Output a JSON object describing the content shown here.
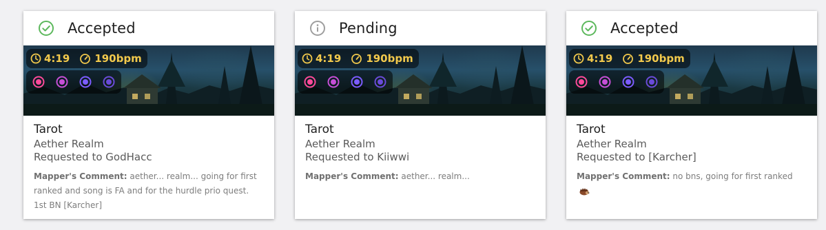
{
  "cards": [
    {
      "status": "Accepted",
      "status_icon": "check-circle-icon",
      "status_color": "#5cb85c",
      "length": "4:19",
      "bpm": "190bpm",
      "title": "Tarot",
      "artist": "Aether Realm",
      "requested_to": "Requested to GodHacc",
      "comment_label": "Mapper's Comment:",
      "comment_text": "aether... realm... going for first ranked and song is FA and for the hurdle prio quest. 1st BN [Karcher]"
    },
    {
      "status": "Pending",
      "status_icon": "info-circle-icon",
      "status_color": "#9e9e9e",
      "length": "4:19",
      "bpm": "190bpm",
      "title": "Tarot",
      "artist": "Aether Realm",
      "requested_to": "Requested to Kiiwwi",
      "comment_label": "Mapper's Comment:",
      "comment_text": "aether... realm..."
    },
    {
      "status": "Accepted",
      "status_icon": "check-circle-icon",
      "status_color": "#5cb85c",
      "length": "4:19",
      "bpm": "190bpm",
      "title": "Tarot",
      "artist": "Aether Realm",
      "requested_to": "Requested to [Karcher]",
      "comment_label": "Mapper's Comment:",
      "comment_text": "no bns, going for first ranked",
      "comment_emoji": "hedgehog-icon"
    }
  ],
  "difficulty_colors": [
    "#ff4a9a",
    "#c64fd6",
    "#7c5cff",
    "#6a4bd9"
  ],
  "accent_color": "#f2c94c"
}
